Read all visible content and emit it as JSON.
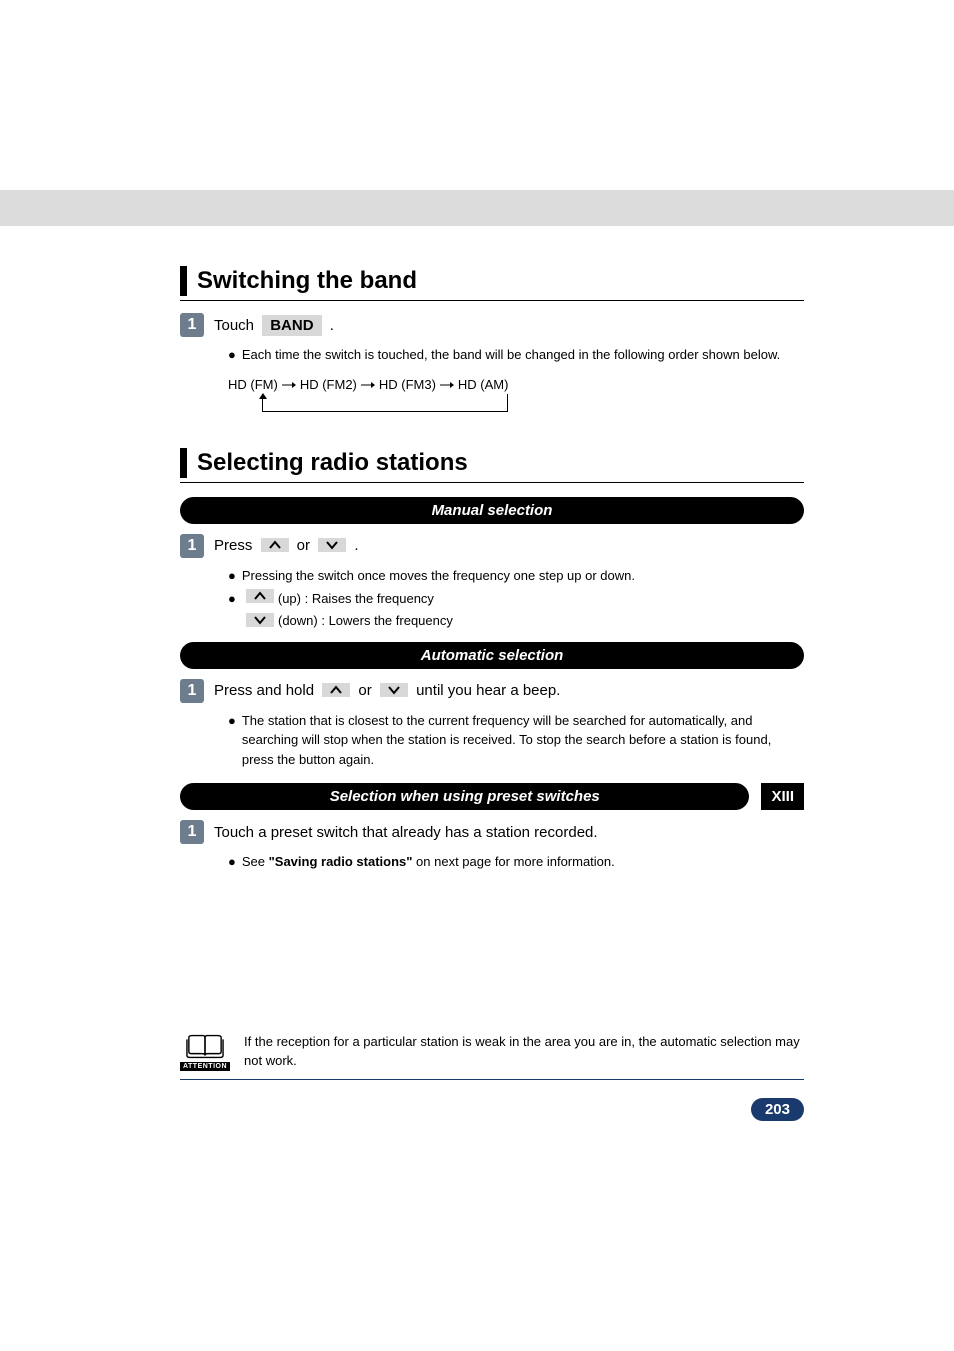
{
  "section1": {
    "heading": "Switching the band",
    "step_badge": "1",
    "step_prefix": "Touch ",
    "step_label": "BAND",
    "step_suffix": " .",
    "bullet": "Each time the switch is touched, the band will be changed in the following order shown below.",
    "order": {
      "item1": "HD (FM)",
      "item2": "HD (FM2)",
      "item3": "HD (FM3)",
      "item4": "HD (AM)"
    }
  },
  "section2": {
    "heading": "Selecting radio stations",
    "sub1": {
      "title": "Manual selection",
      "step_badge": "1",
      "step_prefix": "Press ",
      "step_mid": " or ",
      "step_suffix": " .",
      "bullet1": "Pressing the switch once moves the frequency one step up or down.",
      "bullet2_suffix": " (up) : Raises the frequency",
      "bullet3_suffix": " (down) : Lowers the frequency"
    },
    "sub2": {
      "title": "Automatic selection",
      "step_badge": "1",
      "step_prefix": "Press and hold ",
      "step_mid": " or ",
      "step_suffix": " until you hear a beep.",
      "bullet": "The station that is closest to the current frequency will be searched for automatically, and searching will stop when the station is received. To stop the search before a station is found, press the button again."
    },
    "sub3": {
      "title": "Selection when using preset switches",
      "side_tab": "XIII",
      "step_badge": "1",
      "step_text": "Touch a preset switch that already has a station recorded.",
      "bullet_prefix": "See ",
      "bullet_bold": "\"Saving radio stations\"",
      "bullet_suffix": " on next page for more information."
    }
  },
  "attention": {
    "label": "ATTENTION",
    "text": "If the reception for a particular station is weak in the area you are in, the automatic selection may not work."
  },
  "page_number": "203"
}
